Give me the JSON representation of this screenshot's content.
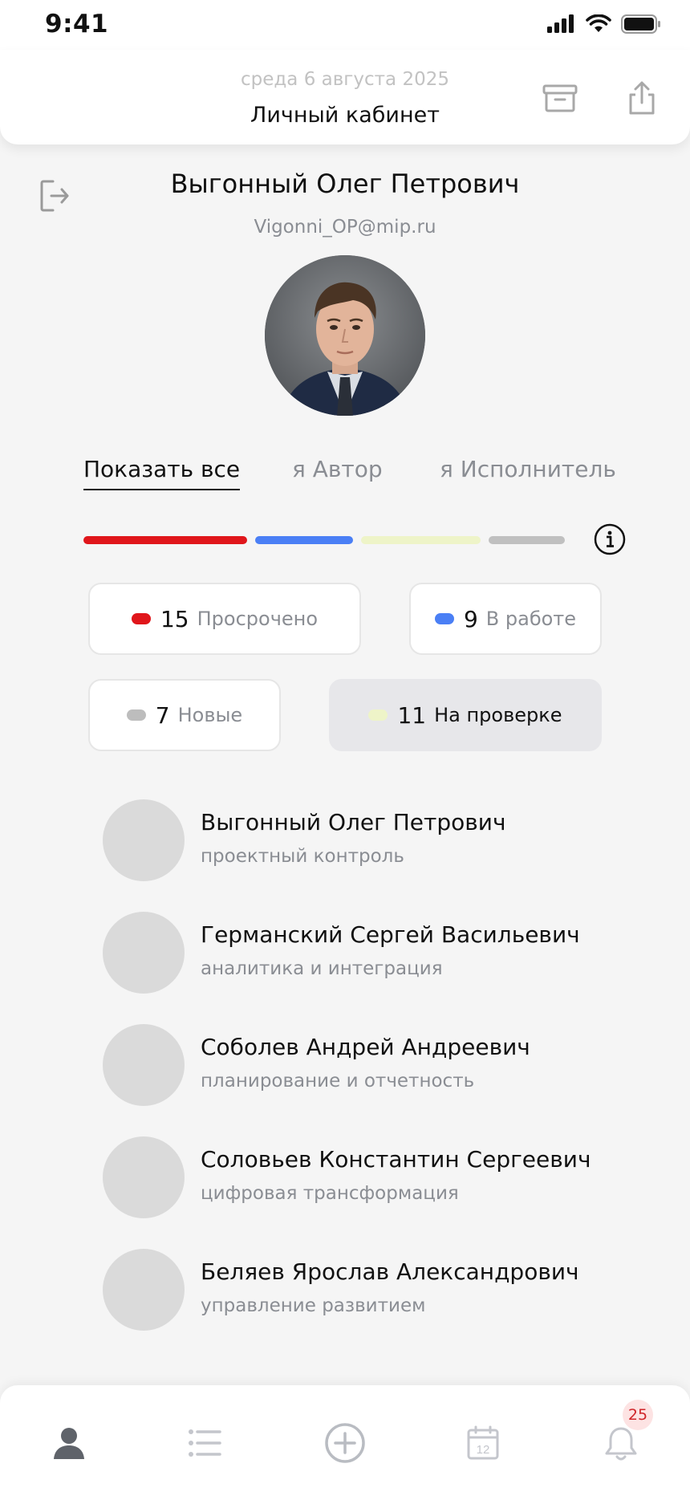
{
  "status_bar": {
    "time": "9:41"
  },
  "header": {
    "date": "среда 6 августа 2025",
    "title": "Личный кабинет"
  },
  "profile": {
    "name": "Выгонный Олег Петрович",
    "email": "Vigonni_OP@mip.ru"
  },
  "tabs": [
    {
      "label": "Показать все",
      "active": true
    },
    {
      "label": "я Автор",
      "active": false
    },
    {
      "label": "я Исполнитель",
      "active": false
    }
  ],
  "progress": [
    {
      "status": "Просрочено",
      "count": 15,
      "color": "#e0161b"
    },
    {
      "status": "В работе",
      "count": 9,
      "color": "#4a7ff5"
    },
    {
      "status": "На проверке",
      "count": 11,
      "color": "#eef4c8"
    },
    {
      "status": "Новые",
      "count": 7,
      "color": "#c0c0c0"
    }
  ],
  "chips": [
    {
      "count": "15",
      "label": "Просрочено",
      "color": "#e0161b"
    },
    {
      "count": "9",
      "label": "В работе",
      "color": "#4a7ff5"
    },
    {
      "count": "7",
      "label": "Новые",
      "color": "#bdbdbd"
    },
    {
      "count": "11",
      "label": "На проверке",
      "color": "#eef4c8",
      "selected": true
    }
  ],
  "people": [
    {
      "name": "Выгонный Олег Петрович",
      "dept": "проектный контроль"
    },
    {
      "name": "Германский Сергей Васильевич",
      "dept": "аналитика и интеграция"
    },
    {
      "name": "Соболев  Андрей Андреевич",
      "dept": "планирование и отчетность"
    },
    {
      "name": "Соловьев Константин Сергеевич",
      "dept": "цифровая трансформация"
    },
    {
      "name": "Беляев Ярослав Александрович",
      "dept": "управление развитием"
    }
  ],
  "bottom_nav": {
    "items": [
      {
        "icon": "profile-icon",
        "active": true
      },
      {
        "icon": "list-icon",
        "active": false
      },
      {
        "icon": "add-circle-icon",
        "active": false
      },
      {
        "icon": "calendar-icon",
        "active": false,
        "day": "12"
      },
      {
        "icon": "bell-icon",
        "active": false
      }
    ],
    "notifications_badge": "25"
  },
  "colors": {
    "accent_red": "#e0161b",
    "accent_blue": "#4a7ff5",
    "muted": "#8a8d93"
  }
}
